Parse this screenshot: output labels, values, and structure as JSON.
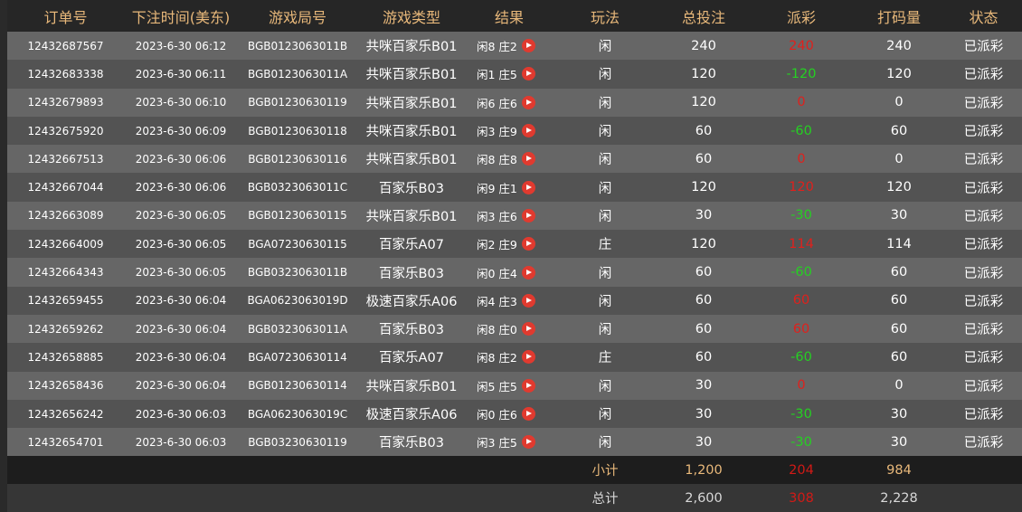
{
  "headers": {
    "order": "订单号",
    "time": "下注时间(美东)",
    "round": "游戏局号",
    "type": "游戏类型",
    "result": "结果",
    "play": "玩法",
    "stake": "总投注",
    "payout": "派彩",
    "turnover": "打码量",
    "status": "状态"
  },
  "rows": [
    {
      "order": "12432687567",
      "time": "2023-6-30 06:12",
      "round": "BGB0123063011B",
      "type": "共咪百家乐B01",
      "result": "闲8 庄2",
      "play": "闲",
      "stake": "240",
      "payout": "240",
      "payout_color": "#e0201c",
      "turnover": "240",
      "status": "已派彩"
    },
    {
      "order": "12432683338",
      "time": "2023-6-30 06:11",
      "round": "BGB0123063011A",
      "type": "共咪百家乐B01",
      "result": "闲1 庄5",
      "play": "闲",
      "stake": "120",
      "payout": "-120",
      "payout_color": "#25d022",
      "turnover": "120",
      "status": "已派彩"
    },
    {
      "order": "12432679893",
      "time": "2023-6-30 06:10",
      "round": "BGB01230630119",
      "type": "共咪百家乐B01",
      "result": "闲6 庄6",
      "play": "闲",
      "stake": "120",
      "payout": "0",
      "payout_color": "#e0201c",
      "turnover": "0",
      "status": "已派彩"
    },
    {
      "order": "12432675920",
      "time": "2023-6-30 06:09",
      "round": "BGB01230630118",
      "type": "共咪百家乐B01",
      "result": "闲3 庄9",
      "play": "闲",
      "stake": "60",
      "payout": "-60",
      "payout_color": "#25d022",
      "turnover": "60",
      "status": "已派彩"
    },
    {
      "order": "12432667513",
      "time": "2023-6-30 06:06",
      "round": "BGB01230630116",
      "type": "共咪百家乐B01",
      "result": "闲8 庄8",
      "play": "闲",
      "stake": "60",
      "payout": "0",
      "payout_color": "#e0201c",
      "turnover": "0",
      "status": "已派彩"
    },
    {
      "order": "12432667044",
      "time": "2023-6-30 06:06",
      "round": "BGB0323063011C",
      "type": "百家乐B03",
      "result": "闲9 庄1",
      "play": "闲",
      "stake": "120",
      "payout": "120",
      "payout_color": "#e0201c",
      "turnover": "120",
      "status": "已派彩"
    },
    {
      "order": "12432663089",
      "time": "2023-6-30 06:05",
      "round": "BGB01230630115",
      "type": "共咪百家乐B01",
      "result": "闲3 庄6",
      "play": "闲",
      "stake": "30",
      "payout": "-30",
      "payout_color": "#25d022",
      "turnover": "30",
      "status": "已派彩"
    },
    {
      "order": "12432664009",
      "time": "2023-6-30 06:05",
      "round": "BGA07230630115",
      "type": "百家乐A07",
      "result": "闲2 庄9",
      "play": "庄",
      "stake": "120",
      "payout": "114",
      "payout_color": "#e0201c",
      "turnover": "114",
      "status": "已派彩"
    },
    {
      "order": "12432664343",
      "time": "2023-6-30 06:05",
      "round": "BGB0323063011B",
      "type": "百家乐B03",
      "result": "闲0 庄4",
      "play": "闲",
      "stake": "60",
      "payout": "-60",
      "payout_color": "#25d022",
      "turnover": "60",
      "status": "已派彩"
    },
    {
      "order": "12432659455",
      "time": "2023-6-30 06:04",
      "round": "BGA0623063019D",
      "type": "极速百家乐A06",
      "result": "闲4 庄3",
      "play": "闲",
      "stake": "60",
      "payout": "60",
      "payout_color": "#e0201c",
      "turnover": "60",
      "status": "已派彩"
    },
    {
      "order": "12432659262",
      "time": "2023-6-30 06:04",
      "round": "BGB0323063011A",
      "type": "百家乐B03",
      "result": "闲8 庄0",
      "play": "闲",
      "stake": "60",
      "payout": "60",
      "payout_color": "#e0201c",
      "turnover": "60",
      "status": "已派彩"
    },
    {
      "order": "12432658885",
      "time": "2023-6-30 06:04",
      "round": "BGA07230630114",
      "type": "百家乐A07",
      "result": "闲8 庄2",
      "play": "庄",
      "stake": "60",
      "payout": "-60",
      "payout_color": "#25d022",
      "turnover": "60",
      "status": "已派彩"
    },
    {
      "order": "12432658436",
      "time": "2023-6-30 06:04",
      "round": "BGB01230630114",
      "type": "共咪百家乐B01",
      "result": "闲5 庄5",
      "play": "闲",
      "stake": "30",
      "payout": "0",
      "payout_color": "#e0201c",
      "turnover": "0",
      "status": "已派彩"
    },
    {
      "order": "12432656242",
      "time": "2023-6-30 06:03",
      "round": "BGA0623063019C",
      "type": "极速百家乐A06",
      "result": "闲0 庄6",
      "play": "闲",
      "stake": "30",
      "payout": "-30",
      "payout_color": "#25d022",
      "turnover": "30",
      "status": "已派彩"
    },
    {
      "order": "12432654701",
      "time": "2023-6-30 06:03",
      "round": "BGB03230630119",
      "type": "百家乐B03",
      "result": "闲3 庄5",
      "play": "闲",
      "stake": "30",
      "payout": "-30",
      "payout_color": "#25d022",
      "turnover": "30",
      "status": "已派彩"
    }
  ],
  "result_icon": "play-circle-icon",
  "subtotal": {
    "label": "小计",
    "stake": "1,200",
    "payout": "204",
    "turnover": "984"
  },
  "total": {
    "label": "总计",
    "stake": "2,600",
    "payout": "308",
    "turnover": "2,228"
  },
  "colors": {
    "header_text": "#e8b87a",
    "payout_positive": "#e0201c",
    "payout_negative": "#25d022",
    "play_icon": "#e03a2f"
  }
}
